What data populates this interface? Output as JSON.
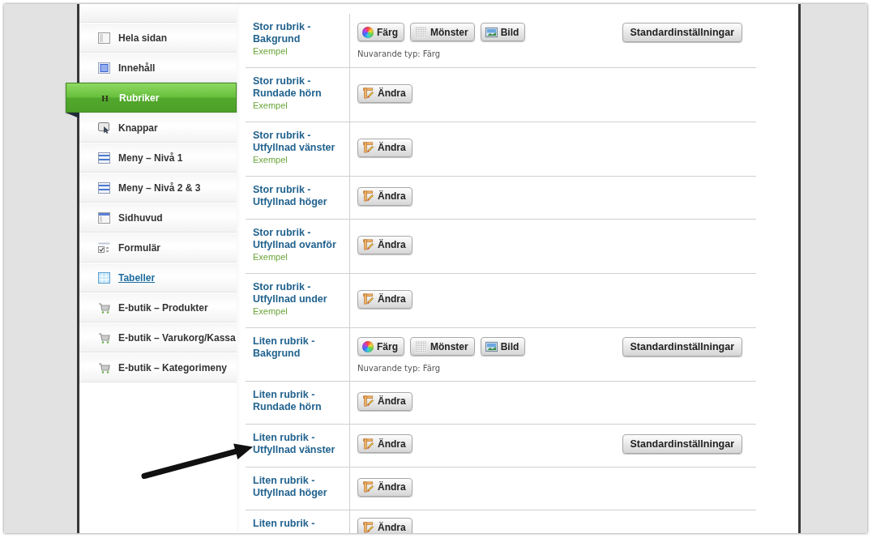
{
  "sidebar": {
    "items": [
      {
        "label": "Hela sidan",
        "kind": "page",
        "selected": false,
        "hovered": false
      },
      {
        "label": "Innehåll",
        "kind": "content",
        "selected": false,
        "hovered": false
      },
      {
        "label": "Rubriker",
        "kind": "heading",
        "glyph": "H",
        "selected": true,
        "hovered": false
      },
      {
        "label": "Knappar",
        "kind": "button",
        "selected": false,
        "hovered": false
      },
      {
        "label": "Meny – Nivå 1",
        "kind": "menu",
        "selected": false,
        "hovered": false
      },
      {
        "label": "Meny – Nivå 2 & 3",
        "kind": "menu",
        "selected": false,
        "hovered": false
      },
      {
        "label": "Sidhuvud",
        "kind": "header",
        "selected": false,
        "hovered": false
      },
      {
        "label": "Formulär",
        "kind": "form",
        "selected": false,
        "hovered": false
      },
      {
        "label": "Tabeller",
        "kind": "table",
        "selected": false,
        "hovered": true
      },
      {
        "label": "E-butik – Produkter",
        "kind": "cart",
        "selected": false,
        "hovered": false
      },
      {
        "label": "E-butik – Varukorg/Kassa",
        "kind": "cart",
        "selected": false,
        "hovered": false
      },
      {
        "label": "E-butik – Kategorimeny",
        "kind": "cart",
        "selected": false,
        "hovered": false
      }
    ]
  },
  "rows": [
    {
      "kind": "type",
      "title": "Stor rubrik - Bakgrund",
      "example": "Exempel",
      "buttons": [
        {
          "kind": "color",
          "label": "Färg"
        },
        {
          "kind": "pattern",
          "label": "Mönster"
        },
        {
          "kind": "image",
          "label": "Bild"
        }
      ],
      "current_type": "Nuvarande typ: Färg",
      "reset": "Standardinställningar"
    },
    {
      "kind": "edit",
      "title": "Stor rubrik - Rundade hörn",
      "example": "Exempel",
      "buttons": [
        {
          "kind": "edit",
          "label": "Ändra"
        }
      ]
    },
    {
      "kind": "edit",
      "title": "Stor rubrik - Utfyllnad vänster",
      "example": "Exempel",
      "buttons": [
        {
          "kind": "edit",
          "label": "Ändra"
        }
      ]
    },
    {
      "kind": "edit",
      "title": "Stor rubrik - Utfyllnad höger",
      "buttons": [
        {
          "kind": "edit",
          "label": "Ändra"
        }
      ]
    },
    {
      "kind": "edit",
      "title": "Stor rubrik - Utfyllnad ovanför",
      "example": "Exempel",
      "buttons": [
        {
          "kind": "edit",
          "label": "Ändra"
        }
      ]
    },
    {
      "kind": "edit",
      "title": "Stor rubrik - Utfyllnad under",
      "example": "Exempel",
      "buttons": [
        {
          "kind": "edit",
          "label": "Ändra"
        }
      ]
    },
    {
      "kind": "type",
      "title": "Liten rubrik - Bakgrund",
      "buttons": [
        {
          "kind": "color",
          "label": "Färg"
        },
        {
          "kind": "pattern",
          "label": "Mönster"
        },
        {
          "kind": "image",
          "label": "Bild"
        }
      ],
      "current_type": "Nuvarande typ: Färg",
      "reset": "Standardinställningar"
    },
    {
      "kind": "edit",
      "title": "Liten rubrik - Rundade hörn",
      "buttons": [
        {
          "kind": "edit",
          "label": "Ändra"
        }
      ]
    },
    {
      "kind": "edit",
      "title": "Liten rubrik - Utfyllnad vänster",
      "buttons": [
        {
          "kind": "edit",
          "label": "Ändra"
        }
      ],
      "reset": "Standardinställningar"
    },
    {
      "kind": "edit",
      "title": "Liten rubrik - Utfyllnad höger",
      "buttons": [
        {
          "kind": "edit",
          "label": "Ändra"
        }
      ]
    },
    {
      "kind": "edit",
      "title": "Liten rubrik -",
      "buttons": [
        {
          "kind": "edit",
          "label": "Ändra"
        }
      ]
    }
  ]
}
